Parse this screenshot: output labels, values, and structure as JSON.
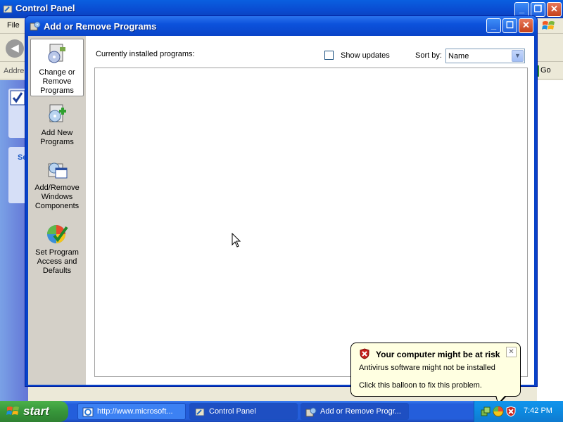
{
  "cp_window": {
    "title": "Control Panel",
    "menu_first": "File",
    "address_label": "Addre",
    "go_label": "Go",
    "left_fragment": "Se"
  },
  "arp_window": {
    "title": "Add or Remove Programs",
    "sidebar": [
      {
        "label": "Change or Remove Programs",
        "icon": "change-remove-programs-icon",
        "selected": true
      },
      {
        "label": "Add New Programs",
        "icon": "add-new-programs-icon",
        "selected": false
      },
      {
        "label": "Add/Remove Windows Components",
        "icon": "windows-components-icon",
        "selected": false
      },
      {
        "label": "Set Program Access and Defaults",
        "icon": "program-access-defaults-icon",
        "selected": false
      }
    ],
    "installed_label": "Currently installed programs:",
    "show_updates_label": "Show updates",
    "show_updates_checked": false,
    "sort_by_label": "Sort by:",
    "sort_by_value": "Name",
    "programs": []
  },
  "balloon": {
    "title": "Your computer might be at risk",
    "line1": "Antivirus software might not be installed",
    "line2": "Click this balloon to fix this problem.",
    "icon": "security-shield-icon"
  },
  "taskbar": {
    "start_label": "start",
    "tasks": [
      {
        "label": "http://www.microsoft...",
        "icon": "ie-icon",
        "active": false
      },
      {
        "label": "Control Panel",
        "icon": "control-panel-icon",
        "active": true
      },
      {
        "label": "Add or Remove Progr...",
        "icon": "add-remove-programs-icon",
        "active": true
      }
    ],
    "clock": "7:42 PM"
  },
  "colors": {
    "xp_blue": "#0842c8",
    "start_green": "#37963a",
    "balloon_bg": "#ffffe1",
    "window_bg": "#ece9d8"
  }
}
